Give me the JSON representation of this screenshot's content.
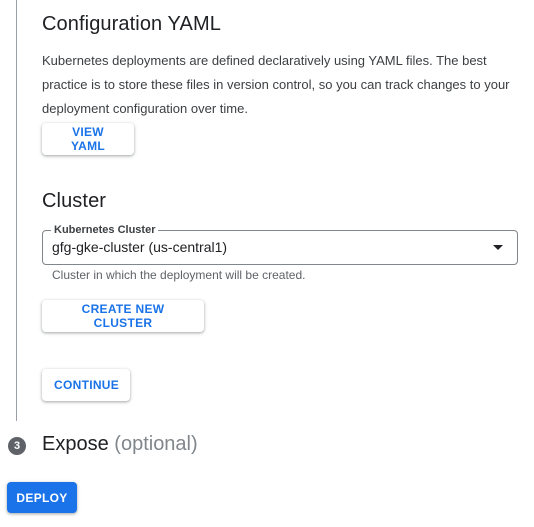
{
  "config_section": {
    "title": "Configuration YAML",
    "description": "Kubernetes deployments are defined declaratively using YAML files. The best practice is to store these files in version control, so you can track changes to your deployment configuration over time.",
    "view_yaml_label": "VIEW YAML"
  },
  "cluster_section": {
    "title": "Cluster",
    "select_label": "Kubernetes Cluster",
    "selected_value": "gfg-gke-cluster (us-central1)",
    "hint": "Cluster in which the deployment will be created.",
    "create_cluster_label": "CREATE NEW CLUSTER",
    "continue_label": "CONTINUE"
  },
  "expose_step": {
    "number": "3",
    "title": "Expose",
    "optional": "(optional)"
  },
  "deploy_label": "DEPLOY",
  "colors": {
    "accent": "#1a73e8",
    "step_badge": "#5f6368"
  }
}
